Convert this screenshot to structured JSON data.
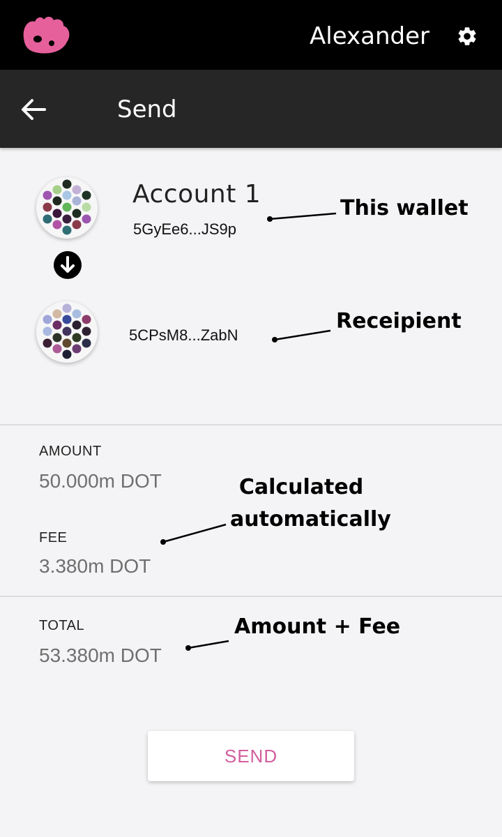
{
  "header": {
    "username": "Alexander",
    "logo_icon": "polkadot-logo-icon",
    "settings_icon": "gear-icon"
  },
  "nav": {
    "title": "Send",
    "back_icon": "arrow-left-icon"
  },
  "sender": {
    "name": "Account 1",
    "address": "5GyEe6...JS9p",
    "avatar_icon": "identicon"
  },
  "direction_icon": "arrow-down-circle-icon",
  "recipient": {
    "address": "5CPsM8...ZabN",
    "avatar_icon": "identicon"
  },
  "summary": {
    "amount_label": "AMOUNT",
    "amount_value": "50.000m DOT",
    "fee_label": "FEE",
    "fee_value": "3.380m DOT",
    "total_label": "TOTAL",
    "total_value": "53.380m DOT"
  },
  "annotations": {
    "this_wallet": "This wallet",
    "recipient": "Receipient",
    "calculated_line1": "Calculated",
    "calculated_line2": "automatically",
    "total": "Amount + Fee"
  },
  "send_label": "SEND",
  "colors": {
    "accent": "#d35e9f",
    "logo": "#e6609c",
    "topbar": "#000000",
    "navbar": "#262626",
    "background": "#f4f4f6"
  }
}
